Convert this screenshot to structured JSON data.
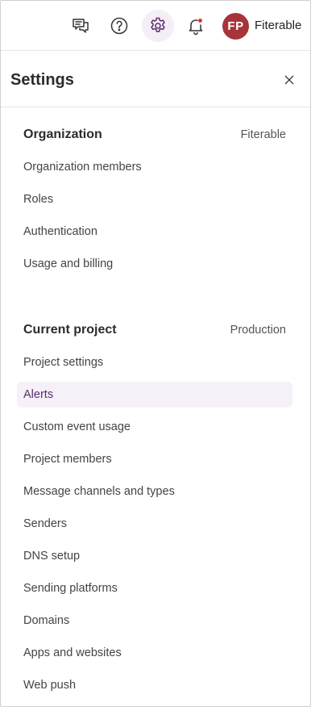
{
  "topbar": {
    "icons": [
      "feedback-icon",
      "help-icon",
      "settings-icon",
      "notifications-icon"
    ],
    "avatar_initials": "FP",
    "org_name": "Fiterable",
    "colors": {
      "avatar_bg": "#a6343a",
      "active_bg": "#f4eef7",
      "notification_dot": "#d93025"
    }
  },
  "panel": {
    "title": "Settings",
    "close_icon": "close-icon"
  },
  "organization": {
    "title": "Organization",
    "value": "Fiterable",
    "items": [
      "Organization members",
      "Roles",
      "Authentication",
      "Usage and billing"
    ]
  },
  "project": {
    "title": "Current project",
    "value": "Production",
    "selected": "Alerts",
    "items": [
      "Project settings",
      "Alerts",
      "Custom event usage",
      "Project members",
      "Message channels and types",
      "Senders",
      "DNS setup",
      "Sending platforms",
      "Domains",
      "Apps and websites",
      "Web push"
    ],
    "colors": {
      "selected_bg": "#f6f0f8",
      "selected_text": "#5a2d6e"
    }
  }
}
